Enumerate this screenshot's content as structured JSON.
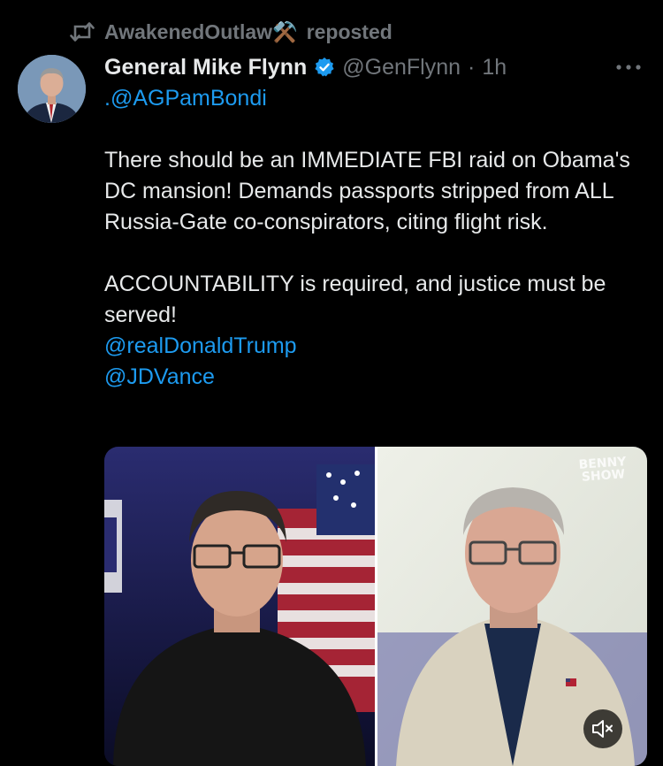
{
  "repost": {
    "user": "AwakenedOutlaw",
    "emoji": "⚒️",
    "suffix": "reposted",
    "icon": "repost-icon"
  },
  "tweet": {
    "author_name": "General Mike Flynn",
    "verified": true,
    "handle": "@GenFlynn",
    "separator": "·",
    "time": "1h",
    "first_mention": ".@AGPamBondi",
    "paragraph1": "There should be an IMMEDIATE FBI raid on Obama's DC mansion! Demands passports stripped from ALL Russia-Gate co-conspirators, citing flight risk.",
    "paragraph2": "ACCOUNTABILITY is required, and justice must be served!",
    "mention_trump": "@realDonaldTrump",
    "mention_vance": "@JDVance"
  },
  "media": {
    "watermark": "BENNY SHOW",
    "mute_icon": "volume-muted-icon"
  },
  "icons": {
    "more": "more-options-icon",
    "verified": "verified-badge-icon"
  },
  "colors": {
    "background": "#000000",
    "text": "#e7e9ea",
    "secondary": "#71767b",
    "link": "#1d9bf0"
  }
}
